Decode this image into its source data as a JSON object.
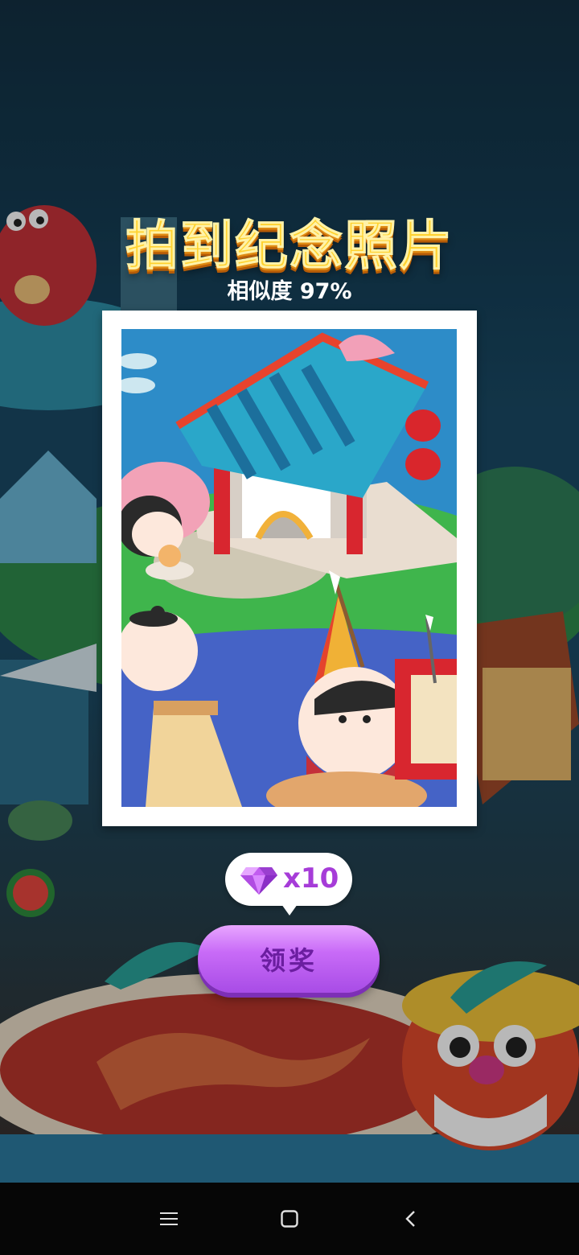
{
  "title": "拍到纪念照片",
  "similarity": "相似度 97%",
  "reward": {
    "icon": "diamond-gem-icon",
    "count": "x10"
  },
  "claim_button": "领奖",
  "navbar": {
    "menu_icon": "menu-icon",
    "home_icon": "home-square-icon",
    "back_icon": "back-chevron-icon"
  },
  "colors": {
    "title": "#ffd22e",
    "claim_button": "#c86bf7",
    "reward_text": "#a63cd8"
  }
}
